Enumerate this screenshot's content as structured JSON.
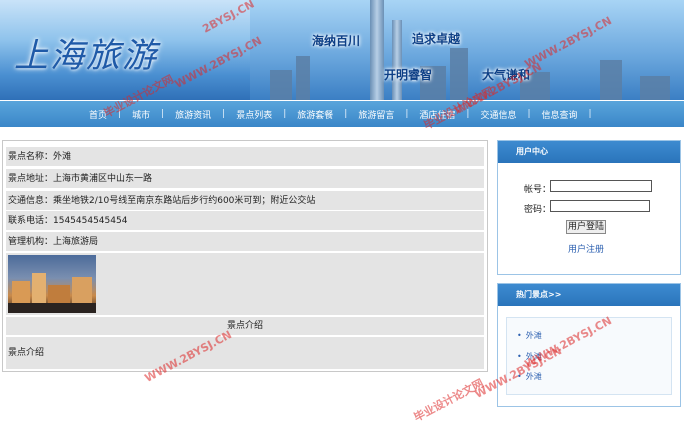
{
  "banner": {
    "logo": "上海旅游",
    "slogans": [
      "海纳百川",
      "追求卓越",
      "开明睿智",
      "大气谦和"
    ]
  },
  "nav": [
    "首页",
    "城市",
    "旅游资讯",
    "景点列表",
    "旅游套餐",
    "旅游留言",
    "酒店住宿",
    "交通信息",
    "信息查询"
  ],
  "detail": {
    "name": "景点名称：外滩",
    "address": "景点地址：上海市黄浦区中山东一路",
    "traffic": "交通信息：乘坐地铁2/10号线至南京东路站后步行约600米可到；附近公交站",
    "phone": "联系电话：1545454545454",
    "agency": "管理机构：上海旅游局",
    "intro_title": "景点介绍",
    "intro_body": "景点介绍"
  },
  "user_center": {
    "title": "用户中心",
    "account_label": "帐号：",
    "password_label": "密码：",
    "login_button": "用户登陆",
    "register_link": "用户注册"
  },
  "hot_spots": {
    "title": "热门景点>>",
    "items": [
      "外滩",
      "外滩",
      "外滩"
    ]
  },
  "watermarks": [
    "2BYSJ.CN",
    "WWW.2BYSJ.CN",
    "毕业设计论文网",
    "WWW.2BYSJ.CN",
    "毕业设计论文网",
    "WWW.2BYSJ.CN",
    "WWW.2BYSJ.CN",
    "WWW.2BYSJ.CN",
    "WWW.2BYSJ.CN",
    "毕业设计论文网"
  ]
}
